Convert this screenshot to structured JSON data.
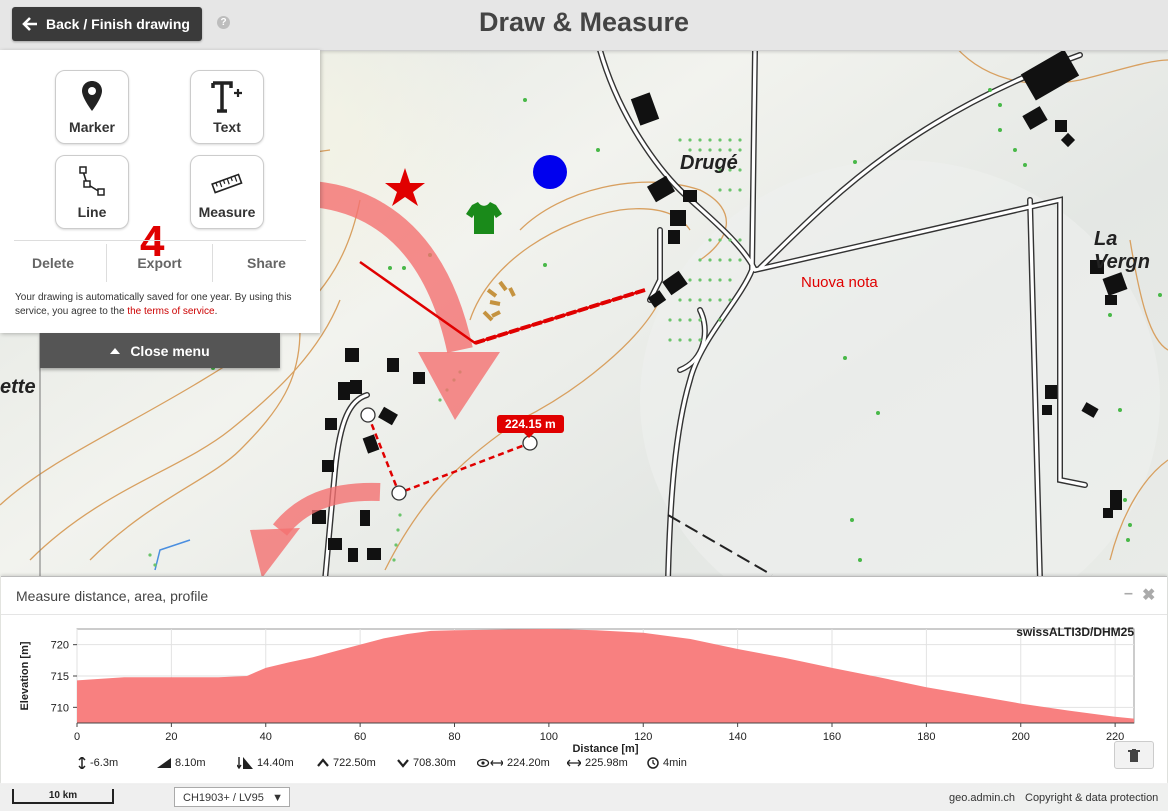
{
  "header": {
    "back_label": "Back / Finish drawing",
    "help_label": "?",
    "title": "Draw & Measure"
  },
  "tools": [
    {
      "label": "Marker",
      "icon": "marker-pin-icon"
    },
    {
      "label": "Text",
      "icon": "text-plus-icon"
    },
    {
      "label": "Line",
      "icon": "line-polyline-icon"
    },
    {
      "label": "Measure",
      "icon": "ruler-icon"
    }
  ],
  "tool_count": "4",
  "actions": {
    "delete": "Delete",
    "export": "Export",
    "share": "Share"
  },
  "notice": {
    "text": "Your drawing is automatically saved for one year. By using this service, you agree to the",
    "link": "the terms of service",
    "end": "."
  },
  "close_menu_label": "Close menu",
  "map": {
    "measure_label": "224.15 m",
    "note_label": "Nuova nota",
    "places": [
      "Drugé",
      "La Vergn",
      "ette"
    ],
    "colors": {
      "drawing": "#e00000",
      "marker_blue": "#0000ee",
      "shirt": "#1a8a1a",
      "arrow": "#f47070"
    }
  },
  "profile": {
    "title": "Measure distance, area, profile",
    "minimize": "–",
    "close": "✖",
    "model": "swissALTI3D/DHM25",
    "stats": [
      {
        "icon": "elevation-diff-icon",
        "value": "-6.3m"
      },
      {
        "icon": "ascent-icon",
        "value": "8.10m"
      },
      {
        "icon": "descent-icon",
        "value": "14.40m"
      },
      {
        "icon": "highest-point-icon",
        "value": "722.50m"
      },
      {
        "icon": "lowest-point-icon",
        "value": "708.30m"
      },
      {
        "icon": "horizontal-distance-icon",
        "value": "224.20m"
      },
      {
        "icon": "slope-distance-icon",
        "value": "225.98m"
      },
      {
        "icon": "hiking-time-icon",
        "value": "4min"
      }
    ]
  },
  "chart_data": {
    "type": "area",
    "title": "",
    "xlabel": "Distance [m]",
    "ylabel": "Elevation [m]",
    "xlim": [
      0,
      224
    ],
    "ylim": [
      707.5,
      722.5
    ],
    "xticks": [
      0,
      20,
      40,
      60,
      80,
      100,
      120,
      140,
      160,
      180,
      200,
      220
    ],
    "yticks": [
      710,
      715,
      720
    ],
    "grid": true,
    "legend": "none",
    "color": "#f88080",
    "x": [
      0,
      10,
      20,
      30,
      36,
      40,
      45,
      50,
      55,
      60,
      65,
      70,
      75,
      80,
      90,
      100,
      110,
      120,
      130,
      140,
      150,
      160,
      170,
      180,
      190,
      200,
      210,
      220,
      224
    ],
    "y": [
      714.3,
      714.8,
      714.8,
      714.8,
      715.0,
      716.3,
      717.2,
      718.0,
      719.0,
      720.0,
      721.0,
      721.7,
      722.2,
      722.3,
      722.4,
      722.5,
      722.3,
      721.9,
      720.9,
      719.3,
      717.9,
      716.3,
      714.8,
      713.2,
      711.9,
      710.6,
      709.5,
      708.5,
      708.2
    ]
  },
  "bottom": {
    "scale_label": "10 km",
    "projection": "CH1903+ / LV95",
    "projection_caret": "▼",
    "brand": "geo.admin.ch",
    "copyright": "Copyright & data protection"
  }
}
